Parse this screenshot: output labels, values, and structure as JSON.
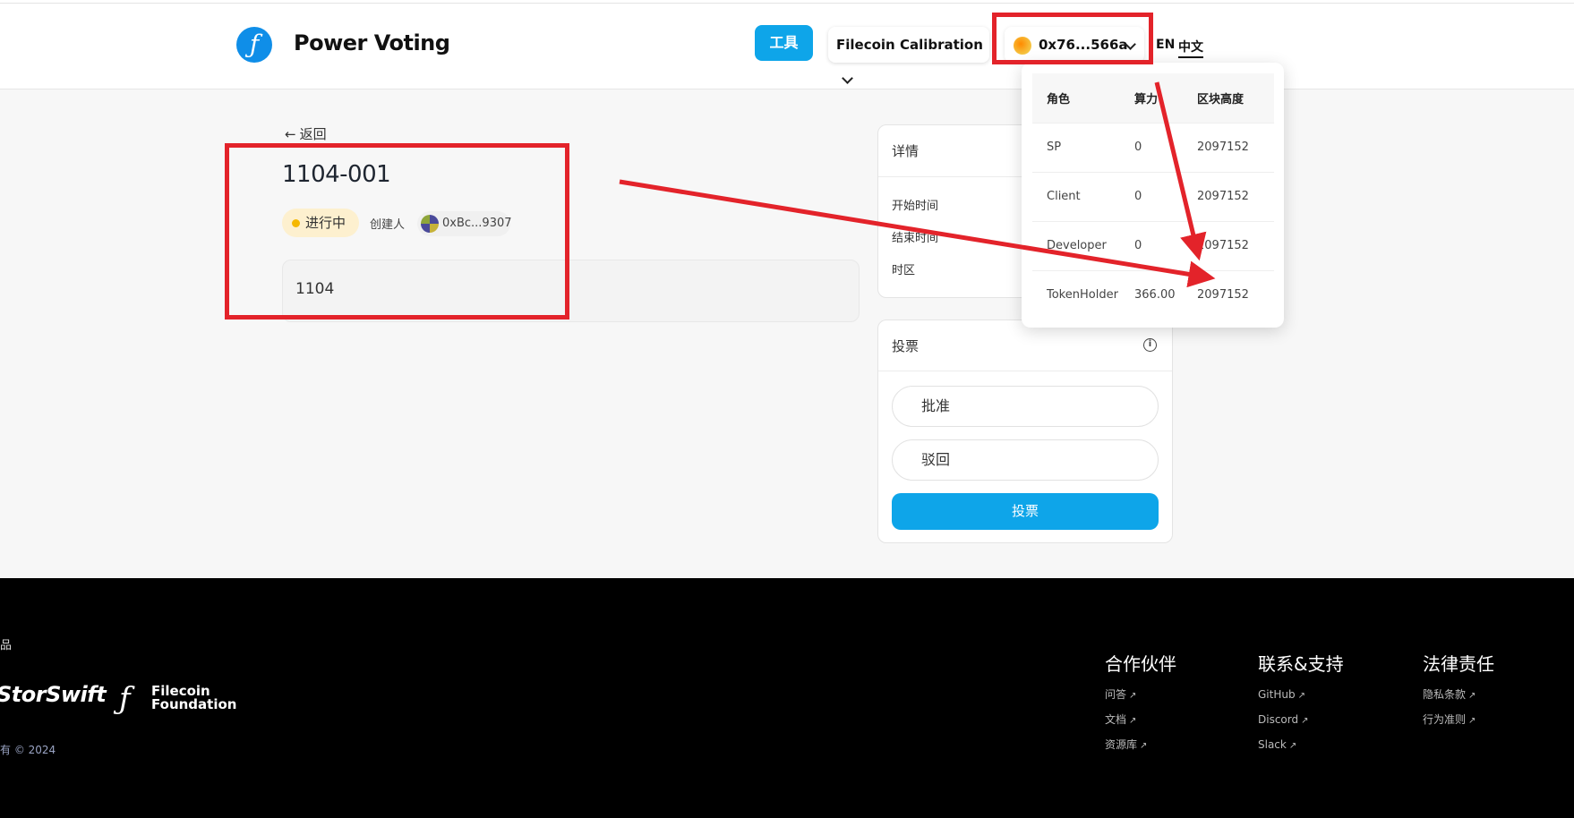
{
  "header": {
    "app_title": "Power Voting",
    "logo_glyph": "ƒ",
    "tools_label": "工具",
    "network": "Filecoin Calibration",
    "wallet_address": "0x76...566a",
    "lang_en": "EN",
    "lang_zh": "中文"
  },
  "power_dropdown": {
    "headers": [
      "角色",
      "算力",
      "区块高度"
    ],
    "rows": [
      {
        "role": "SP",
        "power": "0",
        "height": "2097152"
      },
      {
        "role": "Client",
        "power": "0",
        "height": "2097152"
      },
      {
        "role": "Developer",
        "power": "0",
        "height": "2097152"
      },
      {
        "role": "TokenHolder",
        "power": "366.00",
        "height": "2097152"
      }
    ]
  },
  "proposal": {
    "back_label": "返回",
    "back_arrow": "←",
    "title": "1104-001",
    "status": "进行中",
    "creator_label": "创建人",
    "creator_address": "0xBc...9307",
    "description": "1104"
  },
  "details": {
    "title": "详情",
    "rows": [
      "开始时间",
      "结束时间",
      "时区"
    ]
  },
  "vote": {
    "title": "投票",
    "info_glyph": "i",
    "options": [
      "批准",
      "驳回"
    ],
    "submit_label": "投票"
  },
  "footer": {
    "product_label": "品",
    "storswift": "StorSwift",
    "ff_glyph": "ƒ",
    "ff_line1": "Filecoin",
    "ff_line2": "Foundation",
    "copyright": "有 © 2024",
    "columns": [
      {
        "title": "合作伙伴",
        "links": [
          "问答",
          "文档",
          "资源库"
        ]
      },
      {
        "title": "联系&支持",
        "links": [
          "GitHub",
          "Discord",
          "Slack"
        ]
      },
      {
        "title": "法律责任",
        "links": [
          "隐私条款",
          "行为准则"
        ]
      }
    ],
    "ext_glyph": "↗"
  },
  "colors": {
    "accent": "#0ea5e9",
    "annotation": "#e3232a",
    "status_dot": "#f5b800",
    "status_bg": "#fdf0cf",
    "footer_bg": "#000000"
  }
}
